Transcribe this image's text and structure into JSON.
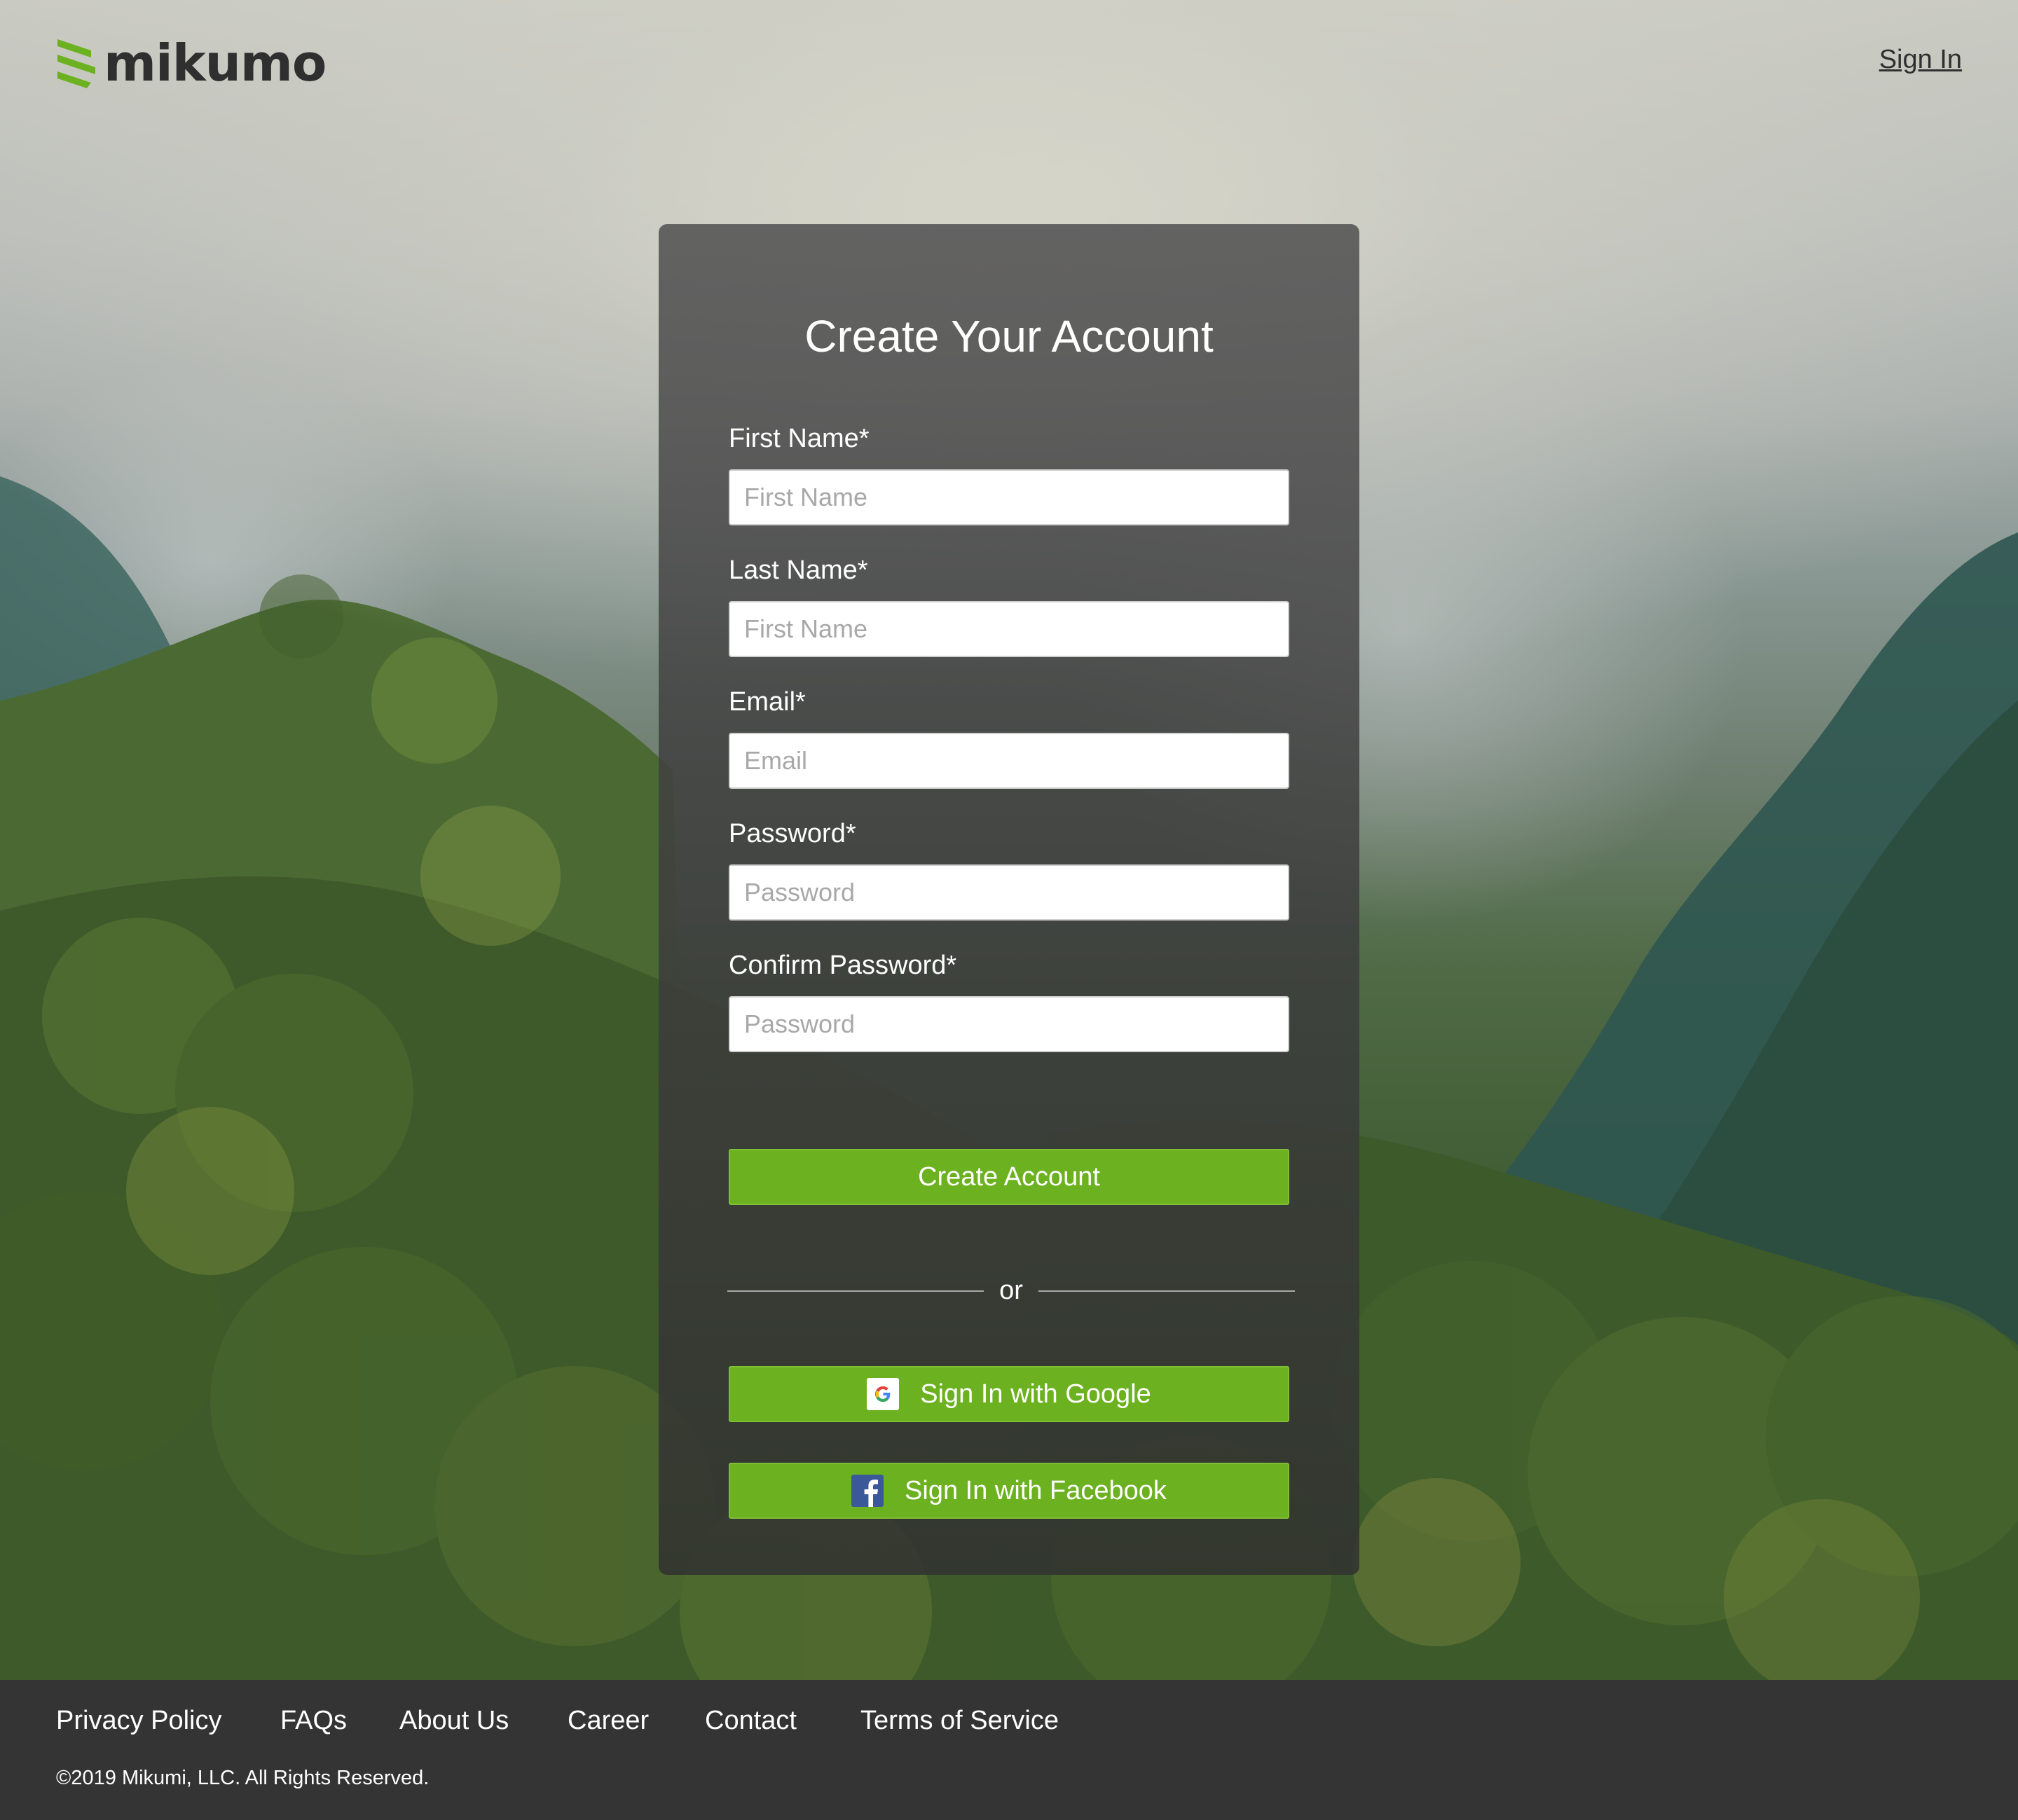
{
  "brand": {
    "name": "mikumo",
    "accent_color": "#6cb11f",
    "logo_icon": "stripes-logo-icon"
  },
  "header": {
    "signin_label": "Sign In"
  },
  "form": {
    "title": "Create Your Account",
    "fields": [
      {
        "label": "First Name*",
        "placeholder": "First Name",
        "value": ""
      },
      {
        "label": "Last Name*",
        "placeholder": "First Name",
        "value": ""
      },
      {
        "label": "Email*",
        "placeholder": "Email",
        "value": ""
      },
      {
        "label": "Password*",
        "placeholder": "Password",
        "value": ""
      },
      {
        "label": "Confirm Password*",
        "placeholder": "Password",
        "value": ""
      }
    ],
    "submit_label": "Create Account",
    "divider_text": "or",
    "google_label": "Sign In with Google",
    "google_icon": "google-icon",
    "facebook_label": "Sign In with Facebook",
    "facebook_icon": "facebook-icon"
  },
  "footer": {
    "links": [
      "Privacy Policy",
      "FAQs",
      "About Us",
      "Career",
      "Contact",
      "Terms of Service"
    ],
    "copyright": "©2019 Mikumi, LLC. All Rights Reserved.",
    "background_color": "#343434"
  }
}
